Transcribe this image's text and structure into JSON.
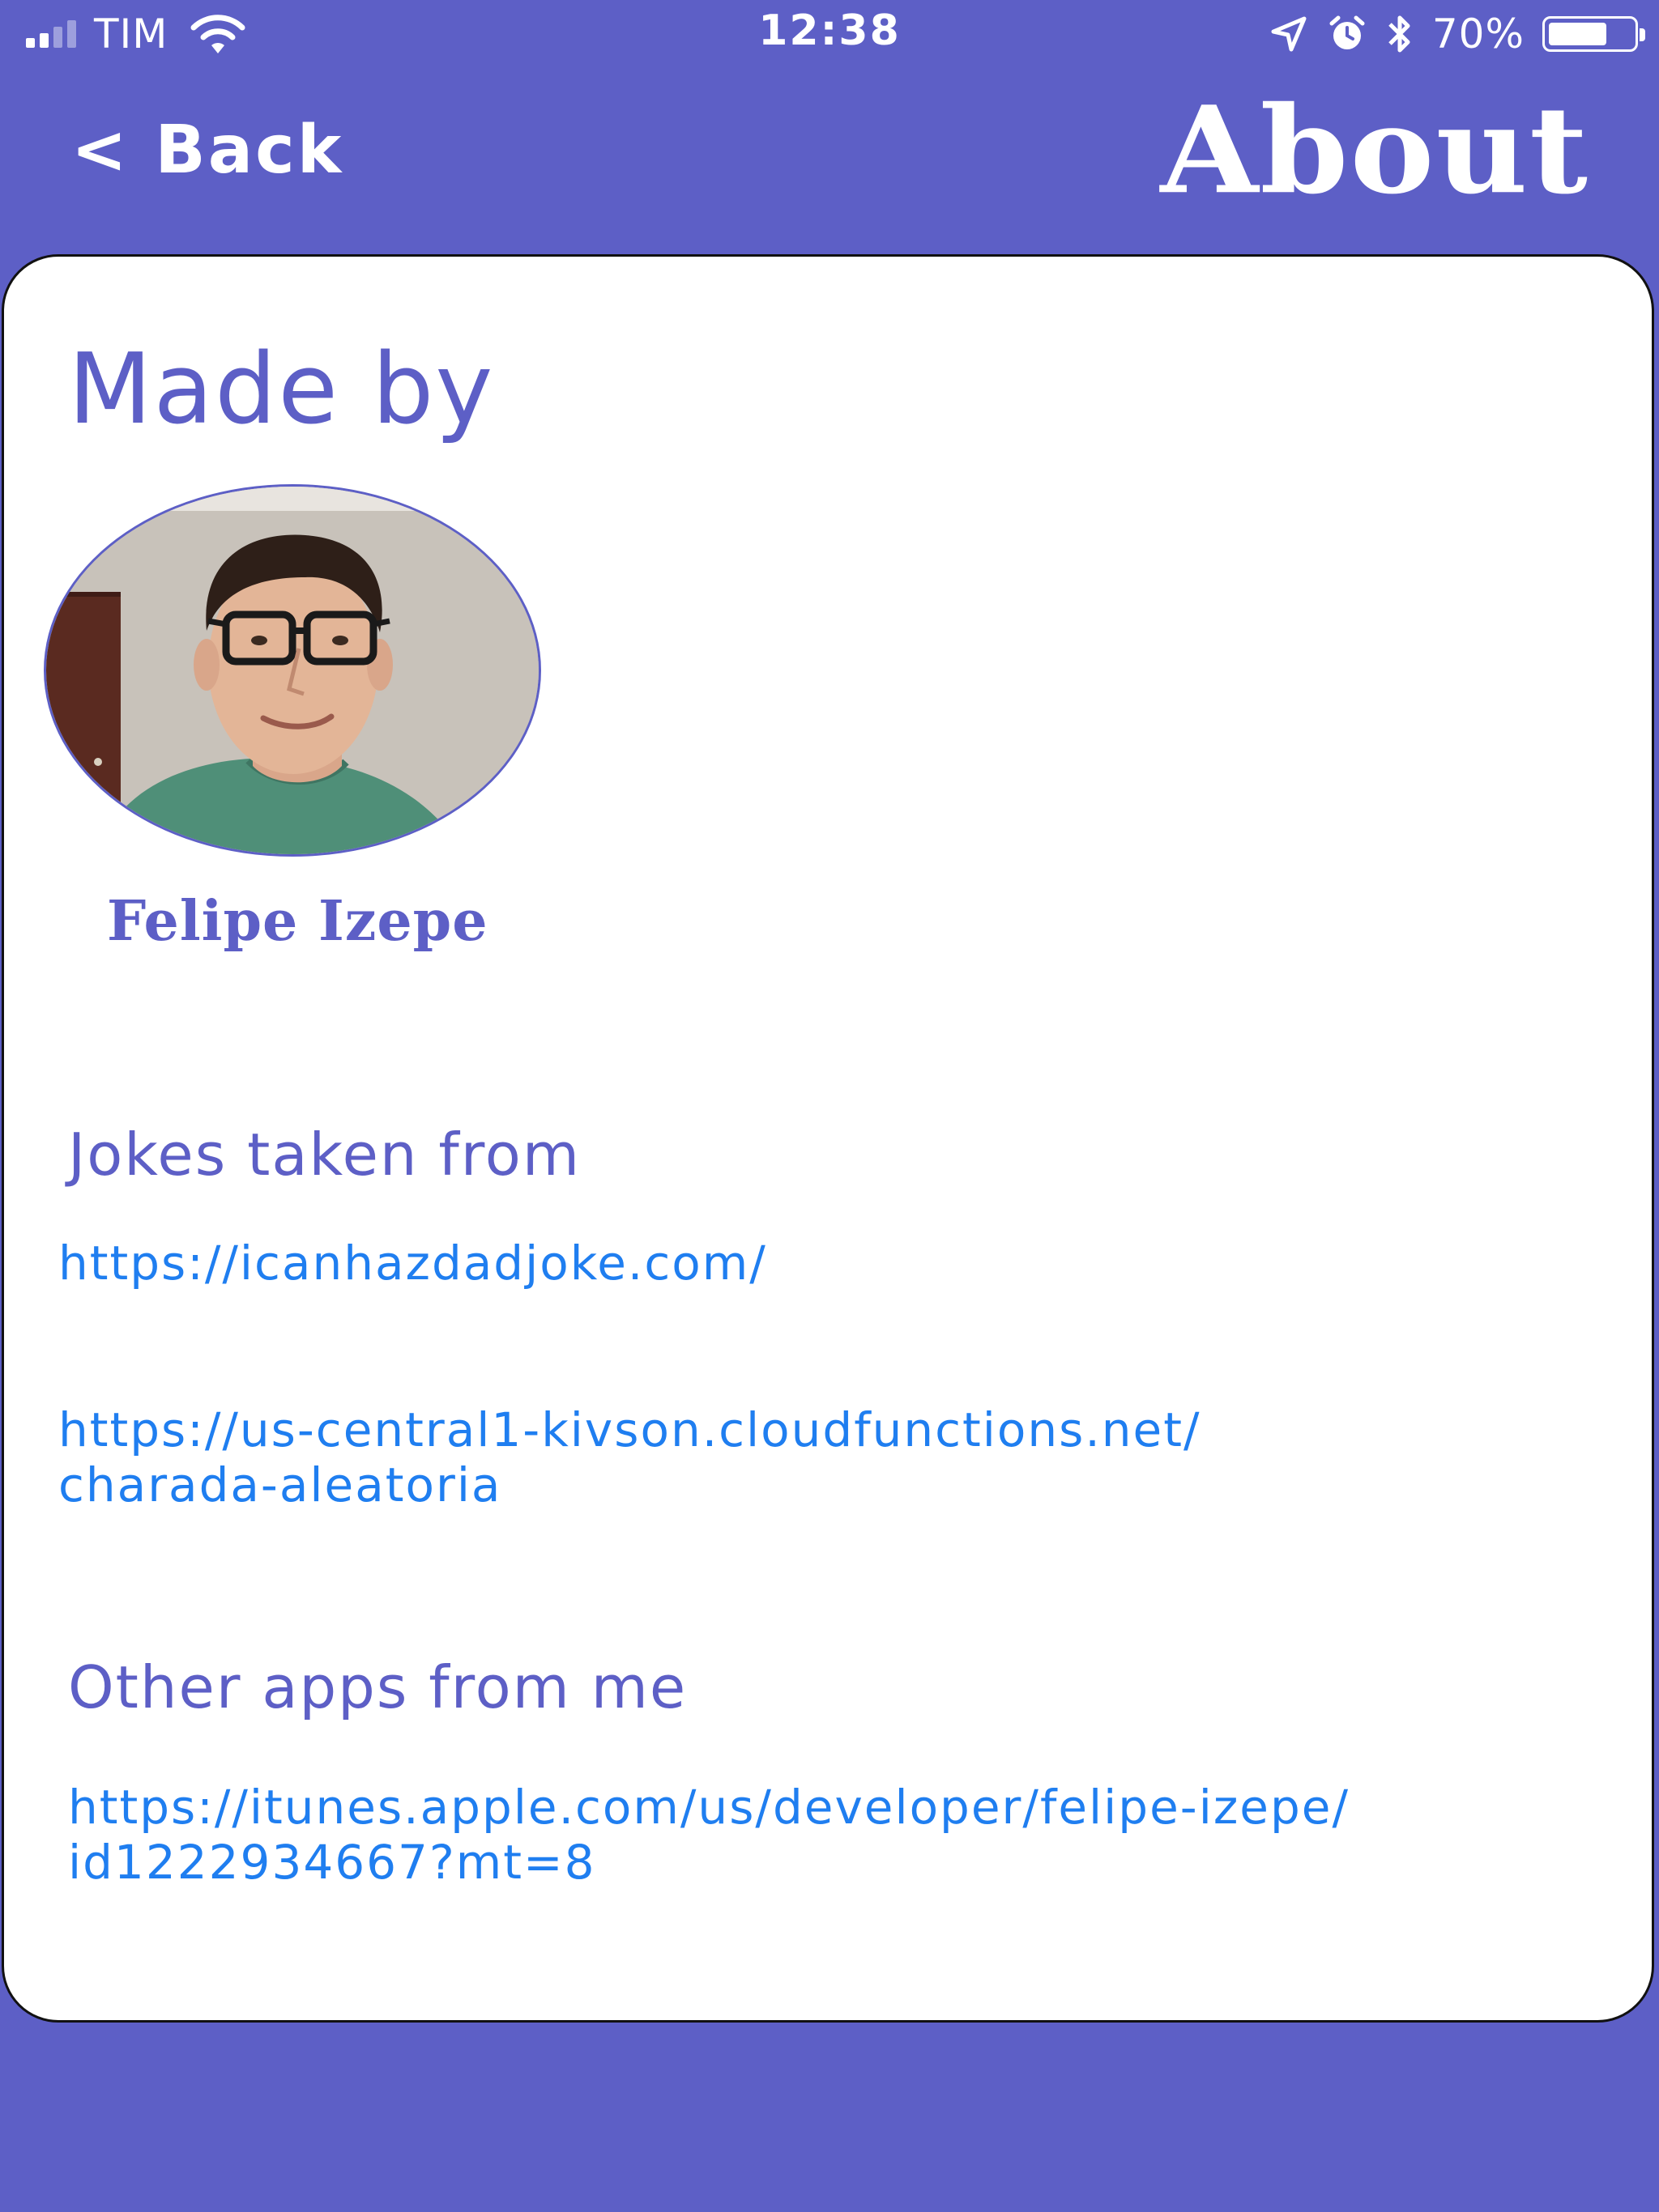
{
  "status_bar": {
    "carrier": "TIM",
    "time": "12:38",
    "battery_percent": "70%",
    "battery_level": 0.7,
    "signal_bars_filled": 2,
    "signal_bars_total": 4,
    "icons": [
      "wifi-icon",
      "location-arrow-icon",
      "alarm-icon",
      "bluetooth-icon",
      "battery-icon"
    ]
  },
  "header": {
    "back_label": "< Back",
    "title": "About"
  },
  "made_by": {
    "title": "Made by",
    "author_name": "Felipe Izepe"
  },
  "jokes": {
    "title": "Jokes taken from",
    "links": [
      "https://icanhazdadjoke.com/",
      "https://us-central1-kivson.cloudfunctions.net/\ncharada-aleatoria"
    ]
  },
  "other_apps": {
    "title": "Other apps from me",
    "link": "https://itunes.apple.com/us/developer/felipe-izepe/\nid1222934667?mt=8"
  },
  "colors": {
    "brand": "#5d5fc6",
    "link": "#1f7ef0",
    "card": "#ffffff"
  }
}
